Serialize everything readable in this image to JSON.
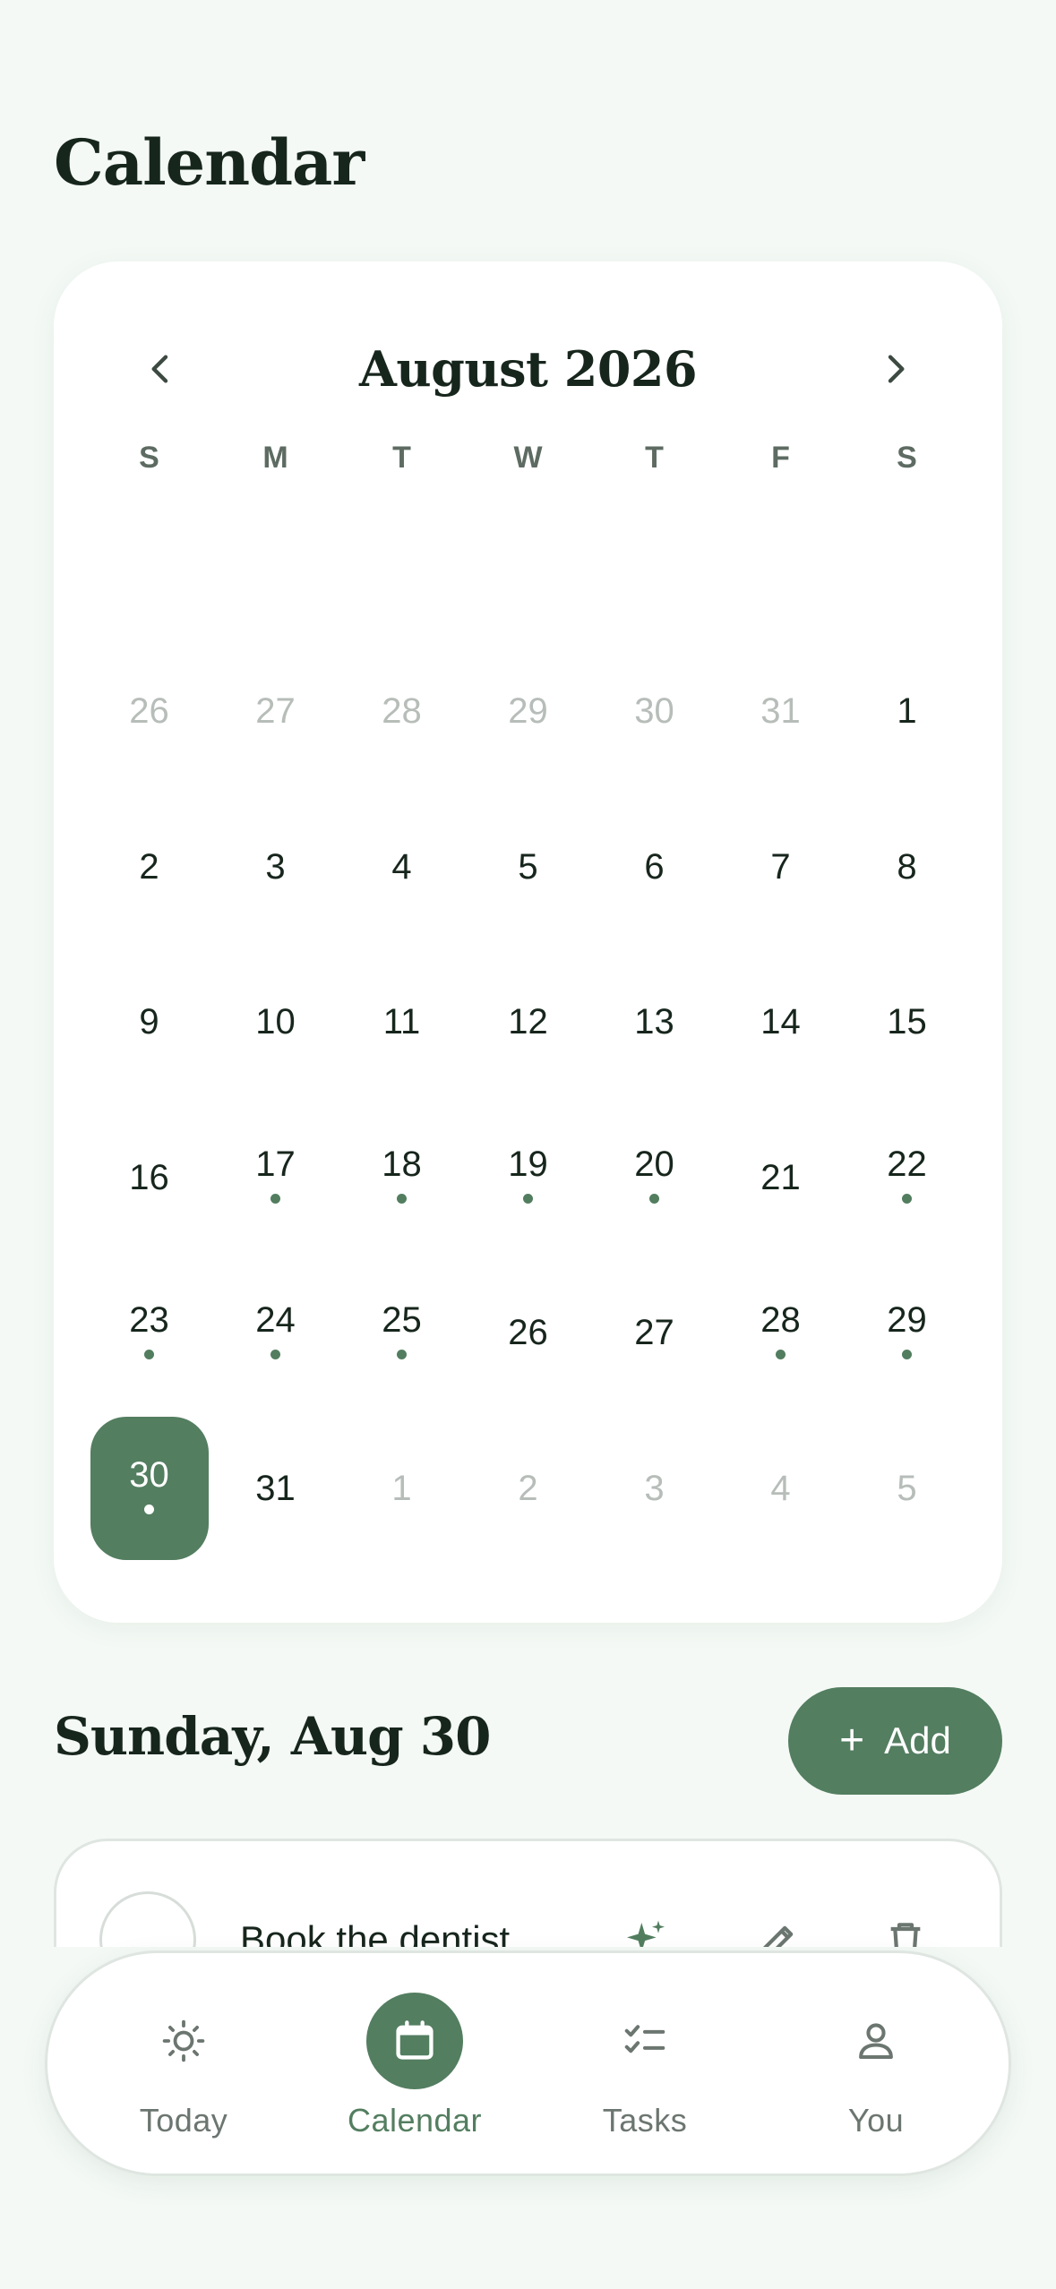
{
  "header": {
    "title": "Calendar"
  },
  "calendar": {
    "month_label": "August 2026",
    "prev_icon": "chevron-left-icon",
    "next_icon": "chevron-right-icon",
    "weekdays": [
      "S",
      "M",
      "T",
      "W",
      "T",
      "F",
      "S"
    ],
    "accent_color": "#537e60",
    "weeks": [
      [
        {
          "d": "26",
          "muted": true
        },
        {
          "d": "27",
          "muted": true
        },
        {
          "d": "28",
          "muted": true
        },
        {
          "d": "29",
          "muted": true
        },
        {
          "d": "30",
          "muted": true
        },
        {
          "d": "31",
          "muted": true
        },
        {
          "d": "1"
        }
      ],
      [
        {
          "d": "2"
        },
        {
          "d": "3"
        },
        {
          "d": "4"
        },
        {
          "d": "5"
        },
        {
          "d": "6"
        },
        {
          "d": "7"
        },
        {
          "d": "8"
        }
      ],
      [
        {
          "d": "9"
        },
        {
          "d": "10"
        },
        {
          "d": "11"
        },
        {
          "d": "12"
        },
        {
          "d": "13"
        },
        {
          "d": "14"
        },
        {
          "d": "15"
        }
      ],
      [
        {
          "d": "16"
        },
        {
          "d": "17",
          "dot": true
        },
        {
          "d": "18",
          "dot": true
        },
        {
          "d": "19",
          "dot": true
        },
        {
          "d": "20",
          "dot": true
        },
        {
          "d": "21"
        },
        {
          "d": "22",
          "dot": true
        }
      ],
      [
        {
          "d": "23",
          "dot": true
        },
        {
          "d": "24",
          "dot": true
        },
        {
          "d": "25",
          "dot": true
        },
        {
          "d": "26"
        },
        {
          "d": "27"
        },
        {
          "d": "28",
          "dot": true
        },
        {
          "d": "29",
          "dot": true
        }
      ],
      [
        {
          "d": "30",
          "dot": true,
          "selected": true
        },
        {
          "d": "31"
        },
        {
          "d": "1",
          "muted": true
        },
        {
          "d": "2",
          "muted": true
        },
        {
          "d": "3",
          "muted": true
        },
        {
          "d": "4",
          "muted": true
        },
        {
          "d": "5",
          "muted": true
        }
      ]
    ]
  },
  "day_section": {
    "heading": "Sunday, Aug 30",
    "add_label": "Add",
    "add_icon": "plus-icon"
  },
  "tasks": [
    {
      "title": "Book the dentist",
      "icons": [
        "sparkle-icon",
        "pencil-icon",
        "trash-icon"
      ]
    }
  ],
  "tabbar": {
    "items": [
      {
        "label": "Today",
        "icon": "sun-icon",
        "active": false
      },
      {
        "label": "Calendar",
        "icon": "calendar-icon",
        "active": true
      },
      {
        "label": "Tasks",
        "icon": "checklist-icon",
        "active": false
      },
      {
        "label": "You",
        "icon": "person-icon",
        "active": false
      }
    ]
  }
}
